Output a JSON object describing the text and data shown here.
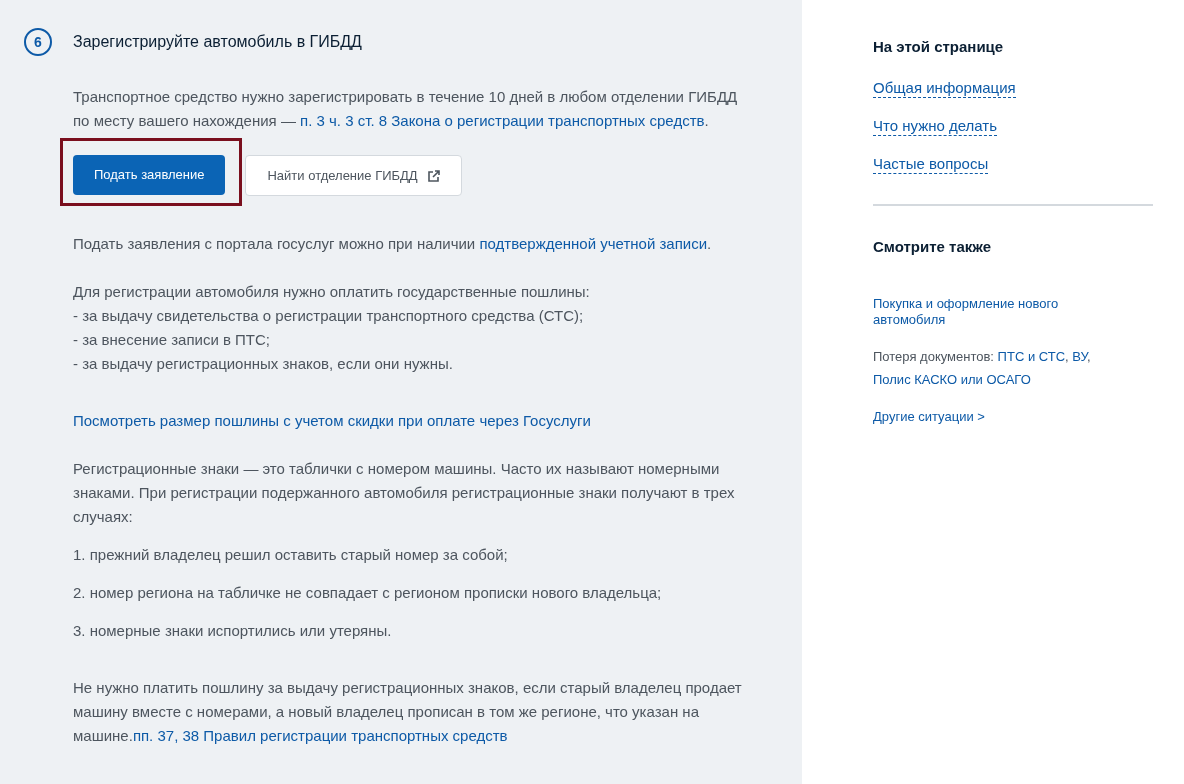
{
  "step": {
    "number": "6",
    "title": "Зарегистрируйте автомобиль в ГИБДД"
  },
  "blocks": [
    {
      "kind": "text",
      "segments": [
        {
          "text": "Транспортное средство нужно зарегистрировать в течение 10 дней в любом отделении ГИБДД по месту вашего нахождения — ",
          "kind": "plain"
        },
        {
          "text": "п. 3 ч. 3 ст. 8 Закона о регистрации транспортных средств",
          "kind": "link"
        },
        {
          "text": ".",
          "kind": "plain"
        }
      ]
    },
    {
      "kind": "buttons",
      "buttons": [
        {
          "label": "Подать заявление",
          "kind": "primary",
          "highlighted": true,
          "external": false
        },
        {
          "label": "Найти отделение ГИБДД",
          "kind": "secondary",
          "highlighted": false,
          "external": true
        }
      ]
    },
    {
      "kind": "text",
      "segments": [
        {
          "text": "Подать заявления с портала госуслуг можно при наличии ",
          "kind": "plain"
        },
        {
          "text": "подтвержденной учетной записи",
          "kind": "link"
        },
        {
          "text": ".",
          "kind": "plain"
        }
      ]
    },
    {
      "kind": "lines",
      "lines": [
        "Для регистрации автомобиля нужно оплатить государственные пошлины:",
        "- за выдачу свидетельства о регистрации транспортного средства (СТС);",
        "- за внесение записи в ПТС;",
        "- за выдачу регистрационных знаков, если они нужны."
      ]
    },
    {
      "kind": "link",
      "text": "Посмотреть размер пошлины с учетом скидки при оплате через Госуслуги"
    },
    {
      "kind": "text",
      "segments": [
        {
          "text": "Регистрационные знаки — это таблички с номером машины. Часто их называют номерными знаками. При регистрации подержанного автомобиля регистрационные знаки получают в трех случаях:",
          "kind": "plain"
        }
      ]
    },
    {
      "kind": "item",
      "text": "1. прежний владелец решил оставить старый номер за собой;"
    },
    {
      "kind": "item",
      "text": "2. номер региона на табличке не совпадает с регионом прописки нового владельца;"
    },
    {
      "kind": "item",
      "text": "3. номерные знаки испортились или утеряны."
    },
    {
      "kind": "text",
      "segments": [
        {
          "text": "Не нужно платить пошлину за выдачу регистрационных знаков, если старый владелец продает машину вместе с номерами, а новый владелец прописан в том же регионе, что указан на машине.",
          "kind": "plain"
        },
        {
          "text": "пп. 37, 38 Правил регистрации транспортных средств",
          "kind": "link"
        }
      ]
    }
  ],
  "sidebar": {
    "on_this_page": {
      "title": "На этой странице",
      "links": [
        "Общая информация",
        "Что нужно делать",
        "Частые вопросы"
      ]
    },
    "see_also": {
      "title": "Смотрите также",
      "entries": [
        {
          "segments": [
            {
              "text": "Покупка и оформление нового автомобиля",
              "kind": "link"
            }
          ]
        },
        {
          "segments": [
            {
              "text": "Потеря документов: ",
              "kind": "plain"
            },
            {
              "text": "ПТС и СТС",
              "kind": "link"
            },
            {
              "text": ", ",
              "kind": "plain"
            },
            {
              "text": "ВУ",
              "kind": "link"
            },
            {
              "text": ", ",
              "kind": "plain"
            },
            {
              "text": "Полис КАСКО или ОСАГО",
              "kind": "link"
            }
          ]
        },
        {
          "segments": [
            {
              "text": "Другие ситуации >",
              "kind": "link"
            }
          ]
        }
      ]
    }
  }
}
